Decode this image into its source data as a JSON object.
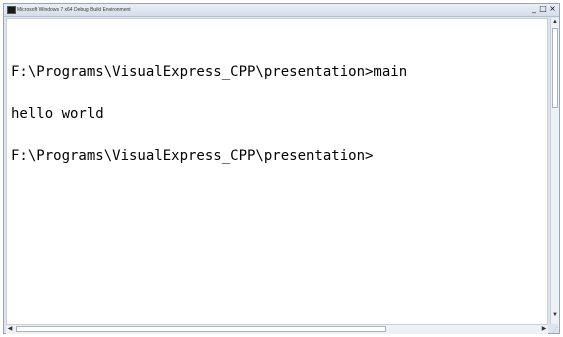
{
  "window": {
    "title": "Microsoft Windows 7 x64 Debug Build Environment",
    "controls": {
      "minimize": "_",
      "maximize": "□",
      "close": "×"
    }
  },
  "console": {
    "lines": [
      "F:\\Programs\\VisualExpress_CPP\\presentation>main",
      "hello world",
      "F:\\Programs\\VisualExpress_CPP\\presentation>"
    ]
  },
  "scrollbars": {
    "up_arrow": "▲",
    "down_arrow": "▼",
    "left_arrow": "◀",
    "right_arrow": "▶"
  },
  "icons": {
    "app": "console-app-icon",
    "resize_grip": "resize-grip-icon"
  },
  "colors": {
    "console_background": "#ffffff",
    "console_text": "#000000",
    "window_frame": "#dbe4ef"
  }
}
